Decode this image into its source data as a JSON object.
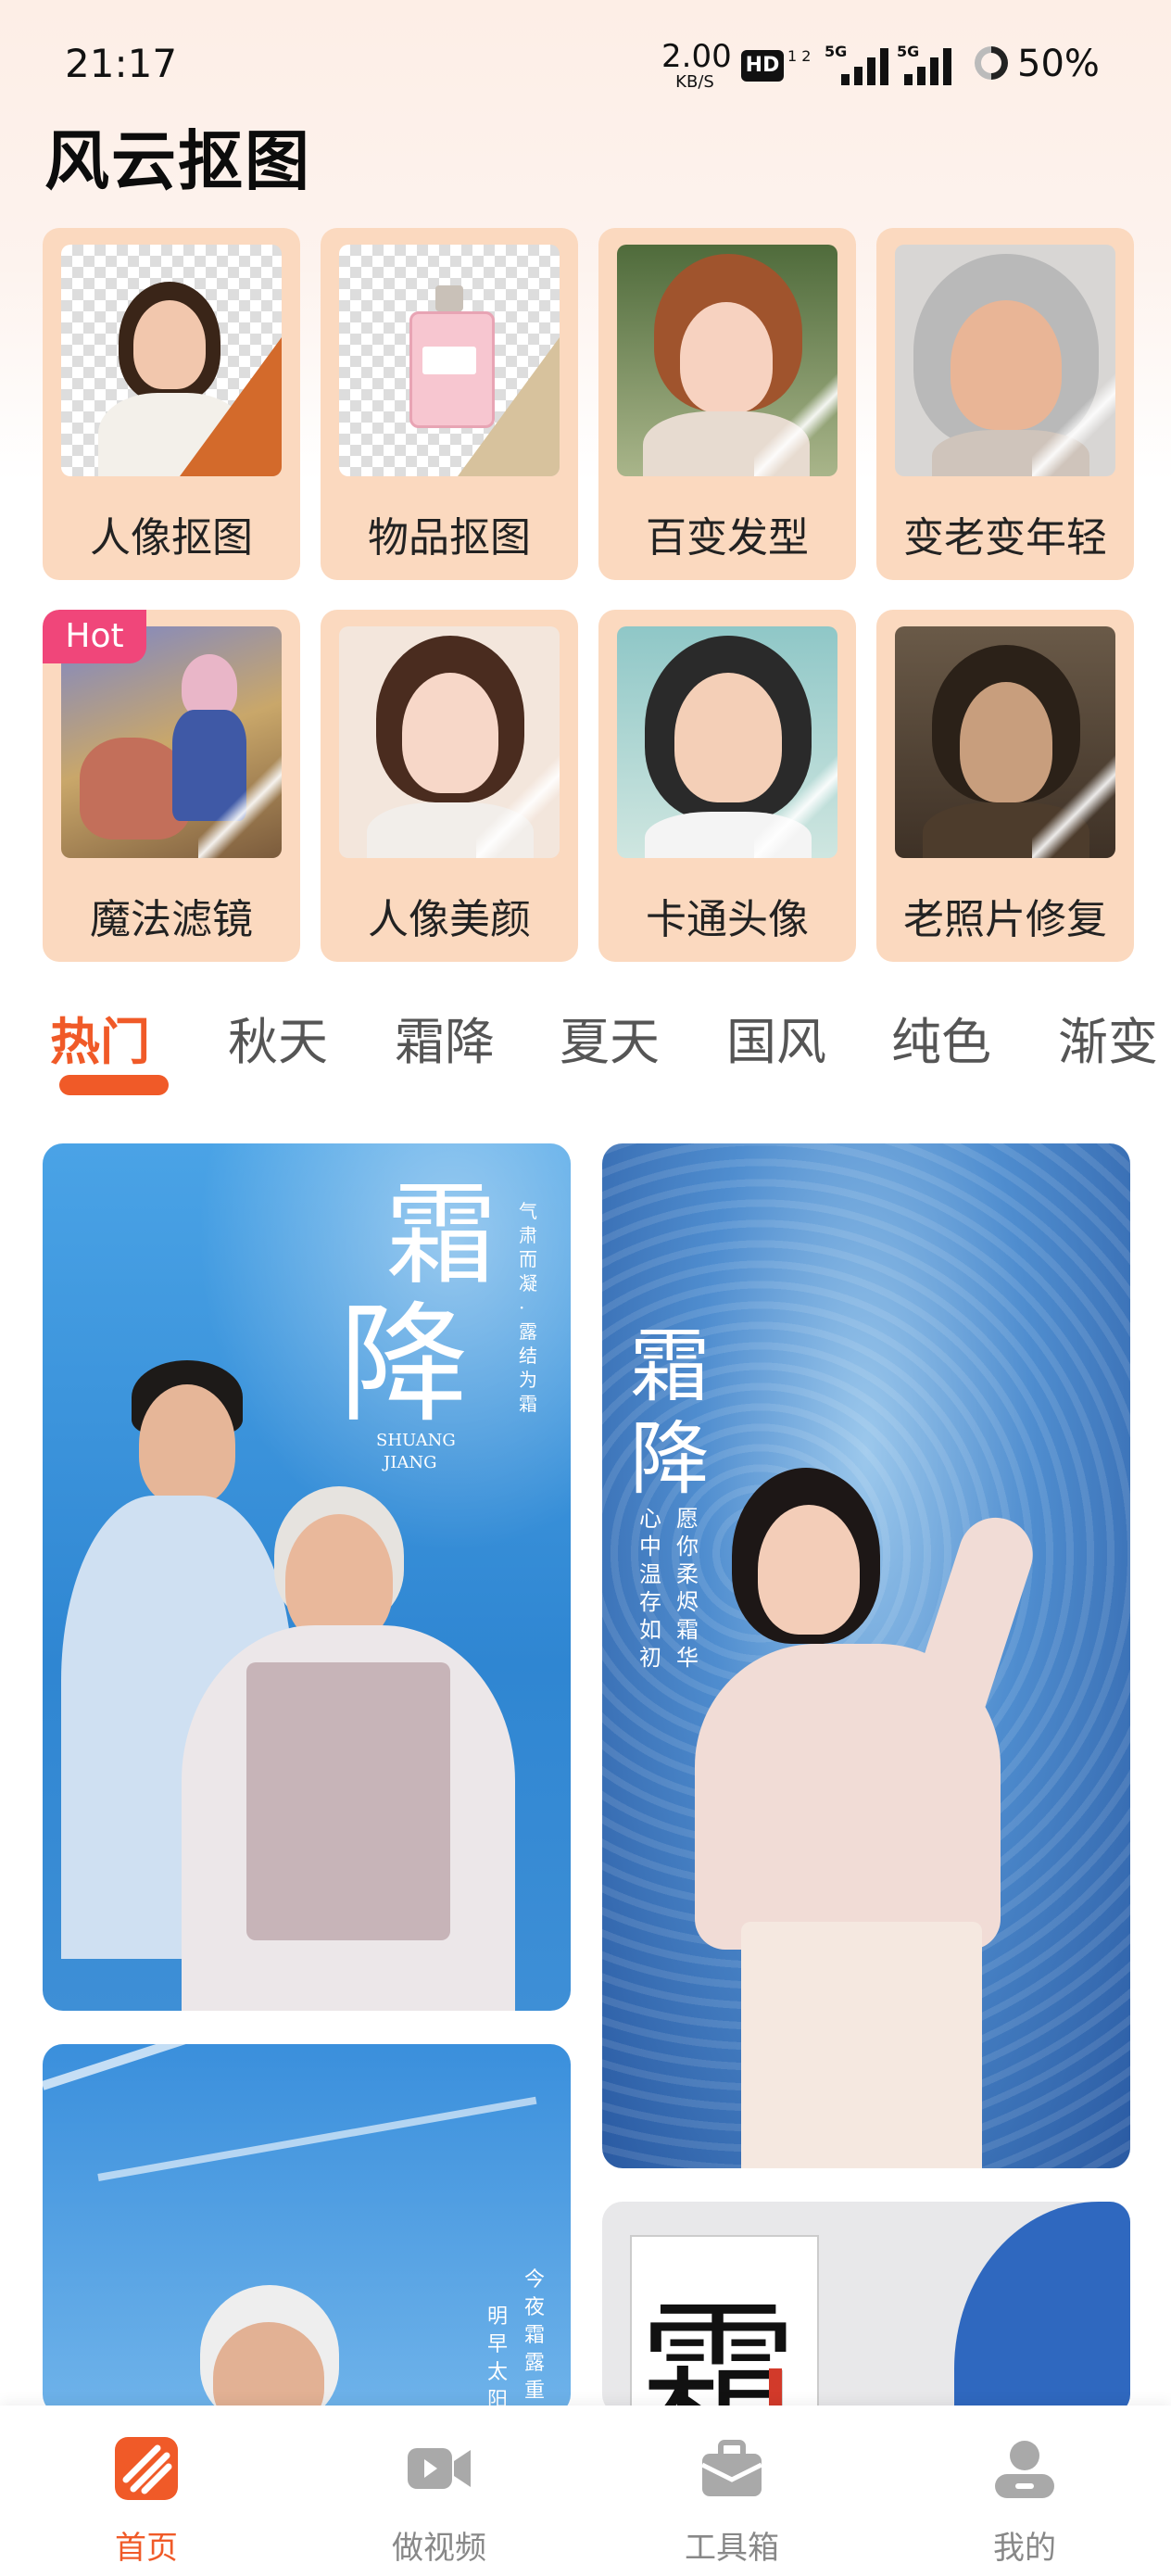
{
  "status_bar": {
    "time": "21:17",
    "net_speed": "2.00",
    "net_unit": "KB/S",
    "hd": "HD",
    "hd_sub": "1 2",
    "sig1": "5G",
    "sig2": "5G",
    "battery": "50%"
  },
  "app": {
    "title": "风云抠图"
  },
  "tools": [
    {
      "label": "人像抠图",
      "icon": "portrait-cutout-icon"
    },
    {
      "label": "物品抠图",
      "icon": "object-cutout-icon"
    },
    {
      "label": "百变发型",
      "icon": "hairstyle-icon"
    },
    {
      "label": "变老变年轻",
      "icon": "age-change-icon"
    },
    {
      "label": "魔法滤镜",
      "icon": "magic-filter-icon",
      "badge": "Hot"
    },
    {
      "label": "人像美颜",
      "icon": "beauty-icon"
    },
    {
      "label": "卡通头像",
      "icon": "cartoon-avatar-icon"
    },
    {
      "label": "老照片修复",
      "icon": "photo-restore-icon"
    }
  ],
  "tabs": [
    {
      "label": "热门",
      "active": true
    },
    {
      "label": "秋天"
    },
    {
      "label": "霜降"
    },
    {
      "label": "夏天"
    },
    {
      "label": "国风"
    },
    {
      "label": "纯色"
    },
    {
      "label": "渐变"
    }
  ],
  "feed": {
    "card1": {
      "title_top": "霜",
      "title_bottom": "降",
      "pinyin_1": "SHUANG",
      "pinyin_2": "JIANG",
      "side_text": "气肃而凝·露结为霜"
    },
    "card2": {
      "title_top": "霜",
      "title_bottom": "降",
      "verse_1": "愿你柔烬霜华",
      "verse_2": "心中温存如初"
    },
    "card3": {
      "verse_1": "今夜霜露重",
      "verse_2": "明早太阳"
    },
    "card4": {
      "title": "霜"
    }
  },
  "bottom_nav": [
    {
      "label": "首页",
      "icon": "home-icon",
      "active": true
    },
    {
      "label": "做视频",
      "icon": "video-camera-icon"
    },
    {
      "label": "工具箱",
      "icon": "toolbox-icon"
    },
    {
      "label": "我的",
      "icon": "profile-icon"
    }
  ],
  "colors": {
    "accent": "#f05a28",
    "card_bg": "#fbd9bf",
    "hot_badge": "#f0467a"
  }
}
